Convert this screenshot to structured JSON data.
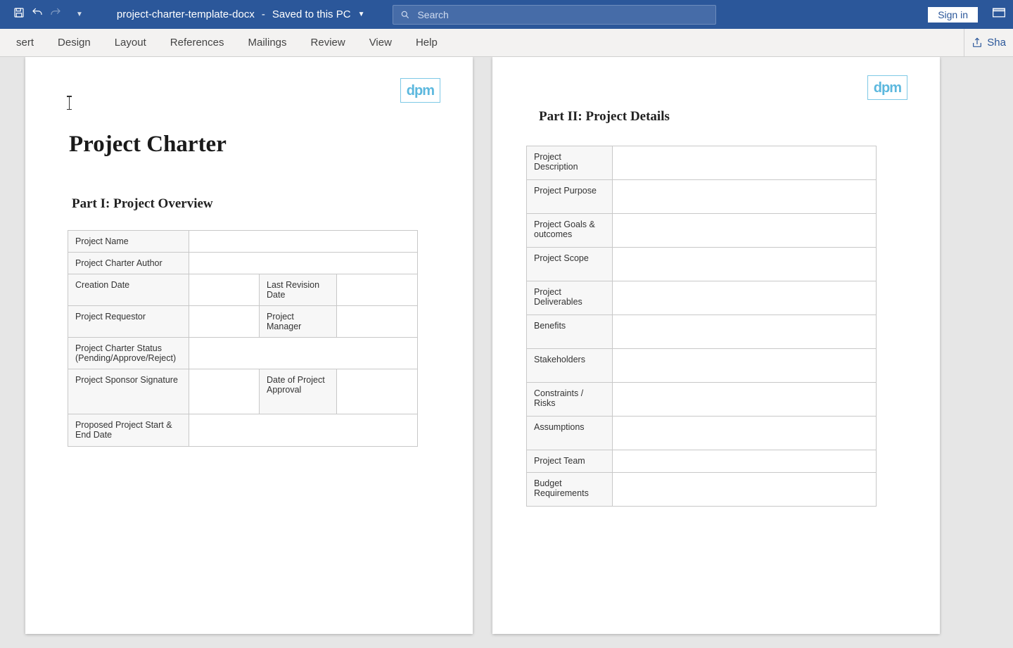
{
  "titlebar": {
    "filename": "project-charter-template-docx",
    "save_status": "Saved to this PC",
    "search_placeholder": "Search",
    "signin": "Sign in"
  },
  "ribbon": {
    "tabs": [
      "sert",
      "Design",
      "Layout",
      "References",
      "Mailings",
      "Review",
      "View",
      "Help"
    ],
    "share": "Sha"
  },
  "page1": {
    "logo": "dpm",
    "title": "Project Charter",
    "section": "Part I: Project Overview",
    "rows": {
      "project_name": "Project Name",
      "author": "Project Charter Author",
      "creation_date": "Creation Date",
      "last_revision": "Last Revision Date",
      "requestor": "Project Requestor",
      "manager": "Project Manager",
      "status": "Project Charter Status (Pending/Approve/Reject)",
      "sponsor_sig": "Project Sponsor Signature",
      "approval_date": "Date of Project Approval",
      "start_end": "Proposed Project Start & End Date"
    }
  },
  "page2": {
    "logo": "dpm",
    "section": "Part II: Project Details",
    "rows": {
      "description": "Project Description",
      "purpose": "Project Purpose",
      "goals": "Project Goals & outcomes",
      "scope": "Project Scope",
      "deliverables": "Project Deliverables",
      "benefits": "Benefits",
      "stakeholders": "Stakeholders",
      "constraints": "Constraints / Risks",
      "assumptions": "Assumptions",
      "team": "Project Team",
      "budget": "Budget Requirements"
    }
  }
}
